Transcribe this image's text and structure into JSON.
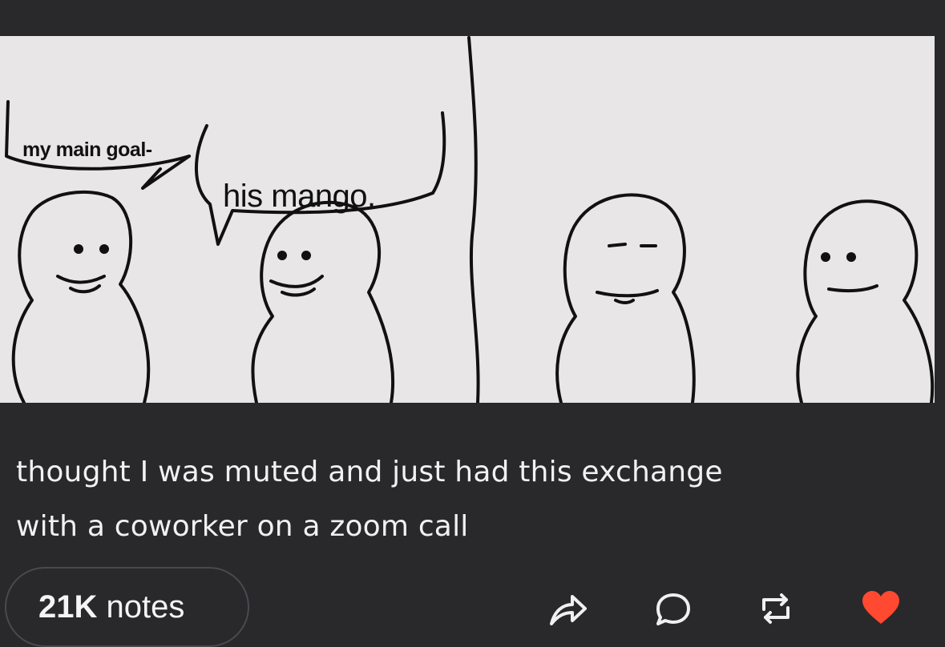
{
  "comic": {
    "speech_left": "my main goal-",
    "speech_right": "his mango."
  },
  "post": {
    "caption_line1": "thought I was muted and just had this exchange",
    "caption_line2": "with a coworker on a zoom call"
  },
  "footer": {
    "notes_count": "21K",
    "notes_label": "notes",
    "icons": [
      "share-icon",
      "reply-icon",
      "reblog-icon",
      "like-icon"
    ],
    "like_color": "#ff4930",
    "icon_color": "#f0f0f0"
  }
}
